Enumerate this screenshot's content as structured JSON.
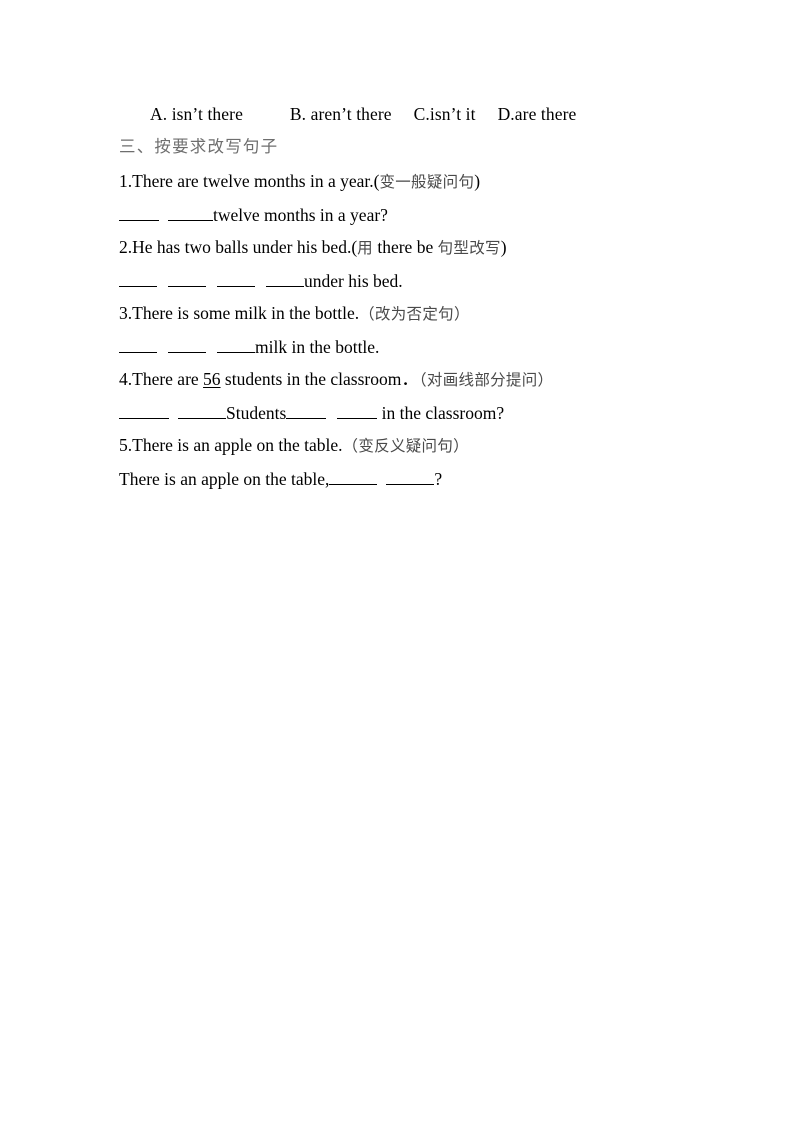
{
  "document": {
    "options_line": {
      "a": "A. isn’t there",
      "b": "B. aren’t there",
      "c": "C.isn’t it",
      "d": "D.are there"
    },
    "section_heading": "三、按要求改写句子",
    "questions": [
      {
        "number": "1.",
        "sentence": "There are twelve months in a year.",
        "paren_open": "(",
        "instruction": "变一般疑问句",
        "paren_close": ")",
        "answer_tail": "twelve months in a year?"
      },
      {
        "number": "2.",
        "sentence": "He has two balls under his bed.",
        "paren_open": "(",
        "instruction_pre": "用",
        "instruction_mid": " there be ",
        "instruction_post": "句型改写",
        "paren_close": ")",
        "answer_tail": "under his bed."
      },
      {
        "number": "3.",
        "sentence": "There is some milk in the bottle.",
        "paren_open": "（",
        "instruction": "改为否定句",
        "paren_close": "）",
        "answer_tail": "milk in the bottle."
      },
      {
        "number": "4.",
        "sentence_pre": "There are ",
        "underlined": "56",
        "sentence_post": " students in the classroom．",
        "paren_open": "（",
        "instruction": "对画线部分提问",
        "paren_close": "）",
        "answer_word": "Students",
        "answer_tail": " in the classroom?"
      },
      {
        "number": "5.",
        "sentence": "There is an apple on the table.",
        "paren_open": "（",
        "instruction": "变反义疑问句",
        "paren_close": "）",
        "answer_head": "There is an apple on the table,",
        "answer_tail": "?"
      }
    ]
  }
}
